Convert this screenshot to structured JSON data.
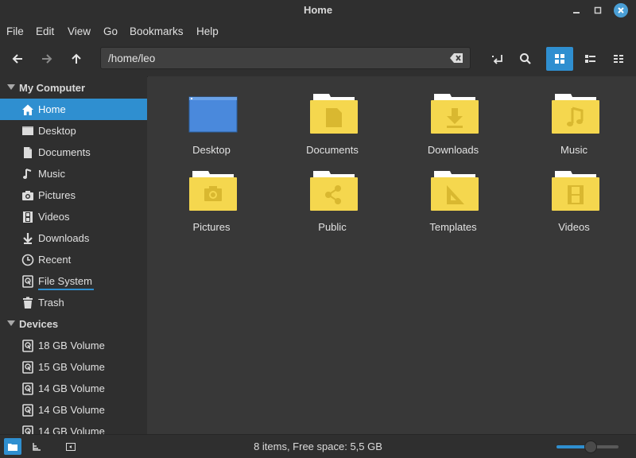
{
  "window": {
    "title": "Home"
  },
  "menu": [
    "File",
    "Edit",
    "View",
    "Go",
    "Bookmarks",
    "Help"
  ],
  "location": {
    "path": "/home/leo"
  },
  "sidebar": {
    "sections": [
      {
        "label": "My Computer"
      },
      {
        "label": "Devices"
      }
    ],
    "my_computer": [
      {
        "label": "Home",
        "icon": "home-icon",
        "selected": true
      },
      {
        "label": "Desktop",
        "icon": "desktop-icon"
      },
      {
        "label": "Documents",
        "icon": "document-icon"
      },
      {
        "label": "Music",
        "icon": "music-icon"
      },
      {
        "label": "Pictures",
        "icon": "camera-icon"
      },
      {
        "label": "Videos",
        "icon": "film-icon"
      },
      {
        "label": "Downloads",
        "icon": "download-icon"
      },
      {
        "label": "Recent",
        "icon": "clock-icon"
      },
      {
        "label": "File System",
        "icon": "drive-icon"
      },
      {
        "label": "Trash",
        "icon": "trash-icon"
      }
    ],
    "devices": [
      {
        "label": "18 GB Volume",
        "icon": "drive-icon"
      },
      {
        "label": "15 GB Volume",
        "icon": "drive-icon"
      },
      {
        "label": "14 GB Volume",
        "icon": "drive-icon"
      },
      {
        "label": "14 GB Volume",
        "icon": "drive-icon"
      },
      {
        "label": "14 GB Volume",
        "icon": "drive-icon"
      }
    ]
  },
  "files": [
    {
      "label": "Desktop",
      "icon": "desktop-folder-icon"
    },
    {
      "label": "Documents",
      "icon": "documents-folder-icon"
    },
    {
      "label": "Downloads",
      "icon": "downloads-folder-icon"
    },
    {
      "label": "Music",
      "icon": "music-folder-icon"
    },
    {
      "label": "Pictures",
      "icon": "pictures-folder-icon"
    },
    {
      "label": "Public",
      "icon": "public-folder-icon"
    },
    {
      "label": "Templates",
      "icon": "templates-folder-icon"
    },
    {
      "label": "Videos",
      "icon": "videos-folder-icon"
    }
  ],
  "status": {
    "text": "8 items, Free space: 5,5 GB",
    "zoom_level": 0.55
  },
  "colors": {
    "accent": "#2f8fd0",
    "folder": "#f5d74e",
    "background": "#383838",
    "panel": "#2f2f2f"
  }
}
